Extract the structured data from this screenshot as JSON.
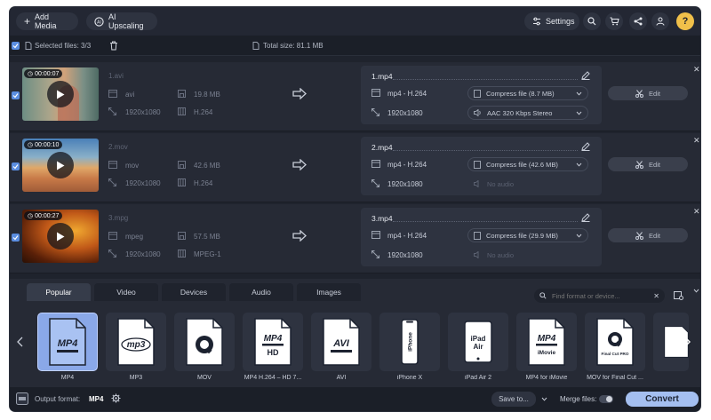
{
  "toolbar": {
    "add_media": "Add Media",
    "ai_upscaling": "AI Upscaling",
    "settings": "Settings"
  },
  "selection": {
    "selected_files": "Selected files: 3/3",
    "total_size": "Total size: 81.1 MB"
  },
  "files": [
    {
      "duration": "00:00:07",
      "name": "1.avi",
      "format": "avi",
      "size": "19.8 MB",
      "resolution": "1920x1080",
      "codec": "H.264",
      "output": {
        "name": "1.mp4",
        "format": "mp4 - H.264",
        "resolution": "1920x1080",
        "compress": "Compress file (8.7 MB)",
        "audio": "AAC 320 Kbps Stereo"
      }
    },
    {
      "duration": "00:00:10",
      "name": "2.mov",
      "format": "mov",
      "size": "42.6 MB",
      "resolution": "1920x1080",
      "codec": "H.264",
      "output": {
        "name": "2.mp4",
        "format": "mp4 - H.264",
        "resolution": "1920x1080",
        "compress": "Compress file (42.6 MB)",
        "audio": "No audio"
      }
    },
    {
      "duration": "00:00:27",
      "name": "3.mpg",
      "format": "mpeg",
      "size": "57.5 MB",
      "resolution": "1920x1080",
      "codec": "MPEG-1",
      "output": {
        "name": "3.mp4",
        "format": "mp4 - H.264",
        "resolution": "1920x1080",
        "compress": "Compress file (29.9 MB)",
        "audio": "No audio"
      }
    }
  ],
  "edit_label": "Edit",
  "tabs": [
    "Popular",
    "Video",
    "Devices",
    "Audio",
    "Images"
  ],
  "format_search": {
    "placeholder": "Find format or device..."
  },
  "formats": [
    {
      "label": "MP4",
      "icon": "MP4"
    },
    {
      "label": "MP3",
      "icon": "mp3"
    },
    {
      "label": "MOV",
      "icon": ""
    },
    {
      "label": "MP4 H.264 – HD 7...",
      "icon": "MP4",
      "sub": "HD"
    },
    {
      "label": "AVI",
      "icon": "AVI"
    },
    {
      "label": "iPhone X",
      "icon": "iPhone"
    },
    {
      "label": "iPad Air 2",
      "icon": "iPad",
      "sub": "Air"
    },
    {
      "label": "MP4 for iMovie",
      "icon": "MP4",
      "sub": "iMovie"
    },
    {
      "label": "MOV for Final Cut ...",
      "icon": "",
      "sub": "Final Cut PRO"
    }
  ],
  "bottom": {
    "output_format_label": "Output format:",
    "output_format_value": "MP4",
    "save_to": "Save to...",
    "merge_files": "Merge files:",
    "convert": "Convert"
  },
  "colors": {
    "accent": "#a4bff0",
    "checkbox": "#5a8de0"
  }
}
